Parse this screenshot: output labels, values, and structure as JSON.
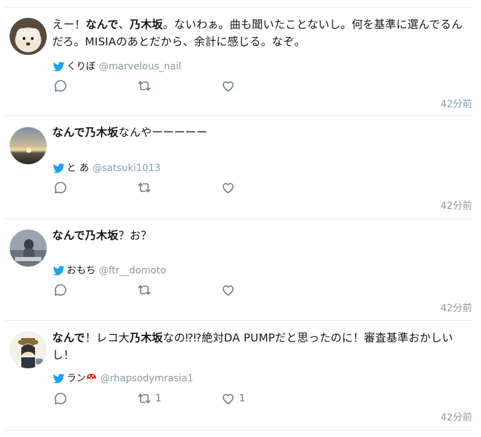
{
  "tweets": [
    {
      "segments": [
        {
          "t": "えー！",
          "b": false
        },
        {
          "t": "なんで",
          "b": true
        },
        {
          "t": "、",
          "b": false
        },
        {
          "t": "乃木坂",
          "b": true
        },
        {
          "t": "。ないわぁ。曲も聞いたことないし。何を基準に選んでるんだろ。MISIAのあとだから、余計に感じる。なぞ。",
          "b": false
        }
      ],
      "display_name": "くりぼ",
      "handle": "@marvelous_nail",
      "reply_count": "",
      "retweet_count": "",
      "like_count": "",
      "time": "42分前"
    },
    {
      "segments": [
        {
          "t": "なんで乃木坂",
          "b": true
        },
        {
          "t": "なんやーーーーー",
          "b": false
        }
      ],
      "display_name": "と あ",
      "handle": "@satsuki1013",
      "reply_count": "",
      "retweet_count": "",
      "like_count": "",
      "time": "42分前"
    },
    {
      "segments": [
        {
          "t": "なんで乃木坂",
          "b": true
        },
        {
          "t": "？お？",
          "b": false
        }
      ],
      "display_name": "おもち",
      "handle": "@ftr__domoto",
      "reply_count": "",
      "retweet_count": "",
      "like_count": "",
      "time": "42分前"
    },
    {
      "segments": [
        {
          "t": "なんで",
          "b": true
        },
        {
          "t": "！レコ大",
          "b": false
        },
        {
          "t": "乃木坂",
          "b": true
        },
        {
          "t": "なの⁉︎⁉︎絶対DA PUMPだと思ったのに！審査基準おかしいし！",
          "b": false
        }
      ],
      "display_name": "ラン",
      "display_emoji": "mushroom-icon",
      "handle": "@rhapsodymrasia1",
      "reply_count": "",
      "retweet_count": "1",
      "like_count": "1",
      "time": "42分前"
    }
  ],
  "icons": {
    "bird": "twitter-bird-icon",
    "reply": "reply-icon",
    "retweet": "retweet-icon",
    "like": "heart-icon"
  },
  "colors": {
    "bird": "#1da1f2",
    "muted": "#8899a6",
    "action": "#657786",
    "separator": "#e6ecf0",
    "text": "#14171a"
  }
}
